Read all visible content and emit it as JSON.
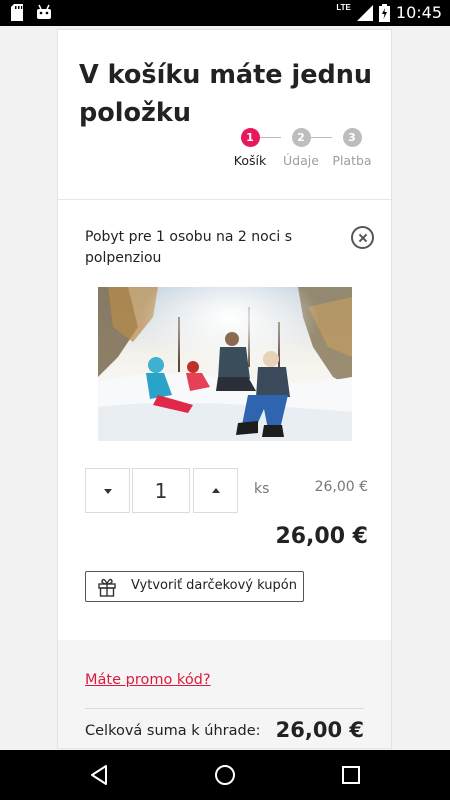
{
  "status_bar": {
    "time": "10:45",
    "network": "LTE",
    "icons": [
      "sd-card-icon",
      "android-icon",
      "signal-icon",
      "battery-icon"
    ]
  },
  "cart": {
    "title": "V košíku máte jednu položku",
    "steps": [
      {
        "number": "1",
        "label": "Košík",
        "state": "active"
      },
      {
        "number": "2",
        "label": "Údaje",
        "state": "inactive"
      },
      {
        "number": "3",
        "label": "Platba",
        "state": "inactive"
      }
    ],
    "item": {
      "name": "Pobyt pre 1 osobu na 2 noci s polpenziou",
      "image_description": "Family sitting in snow in a winter forest",
      "quantity": "1",
      "unit": "ks",
      "unit_price": "26,00 €",
      "total": "26,00 €"
    },
    "gift_button_label": "Vytvoriť darčekový kupón",
    "promo_link": "Máte promo kód?",
    "total_label": "Celková suma k úhrade:",
    "total_value": "26,00 €"
  },
  "colors": {
    "accent": "#e5195c",
    "promo_link": "#d91b3f",
    "step_inactive": "#bdbdbd"
  }
}
